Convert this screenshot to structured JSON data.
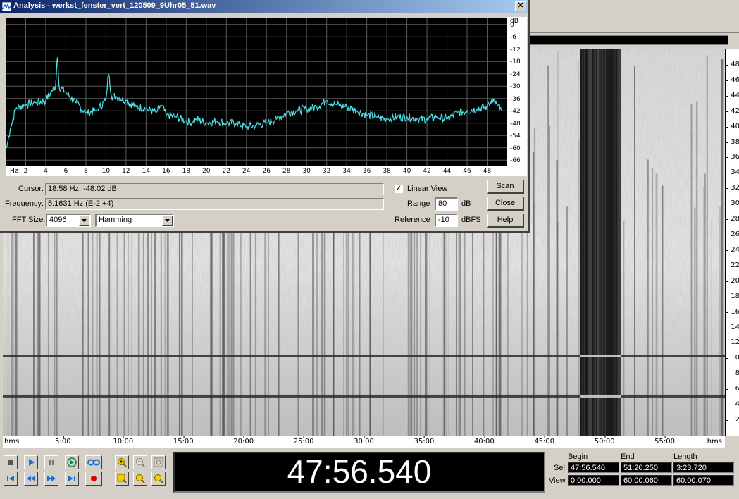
{
  "dialog": {
    "title": "Analysis - werkst_fenster_vert_120509_9Uhr05_51.wav",
    "close_glyph": "✕",
    "cursor_label": "Cursor:",
    "cursor_value": "18.58 Hz, -48.02 dB",
    "frequency_label": "Frequency:",
    "frequency_value": "5.1631 Hz (E-2 +4)",
    "fft_label": "FFT Size:",
    "fft_value": "4096",
    "window_value": "Hamming",
    "linear_view_label": "Linear View",
    "linear_view_checked": "✓",
    "range_label": "Range",
    "range_value": "80",
    "range_unit": "dB",
    "reference_label": "Reference",
    "reference_value": "-10",
    "reference_unit": "dBFS",
    "scan_label": "Scan",
    "close_label": "Close",
    "help_label": "Help"
  },
  "chart_data": {
    "type": "line",
    "x_unit_label": "Hz",
    "y_unit_label": "dB",
    "x_ticks": [
      "2",
      "4",
      "6",
      "8",
      "10",
      "12",
      "14",
      "16",
      "18",
      "20",
      "22",
      "24",
      "26",
      "28",
      "30",
      "32",
      "34",
      "36",
      "38",
      "40",
      "42",
      "44",
      "46",
      "48"
    ],
    "y_ticks": [
      "0",
      "-6",
      "-12",
      "-18",
      "-24",
      "-30",
      "-36",
      "-42",
      "-48",
      "-54",
      "-60",
      "-66"
    ],
    "xlim": [
      0,
      50
    ],
    "ylim": [
      -69,
      3
    ],
    "grid": true,
    "line_color": "#4fe0e8",
    "x": [
      0.1,
      0.5,
      1,
      2,
      3,
      4,
      4.5,
      5,
      5.15,
      5.3,
      6,
      7,
      8,
      9,
      10,
      10.3,
      10.5,
      11,
      12,
      13,
      14,
      15,
      15.5,
      16,
      17,
      18,
      18.6,
      19,
      20,
      21,
      22,
      23,
      24,
      25,
      26,
      27,
      28,
      29,
      30,
      31,
      32,
      33,
      34,
      35,
      36,
      37,
      38,
      39,
      40,
      41,
      42,
      43,
      44,
      45,
      46,
      47,
      48,
      48.5,
      49,
      49.5
    ],
    "y": [
      -60,
      -50,
      -41,
      -39,
      -38,
      -37,
      -33,
      -30,
      -12,
      -30,
      -33,
      -38,
      -43,
      -42,
      -37,
      -21,
      -35,
      -35,
      -37,
      -40,
      -41,
      -43,
      -39,
      -44,
      -45,
      -47,
      -48,
      -46,
      -48,
      -47,
      -48,
      -48,
      -50,
      -49,
      -48,
      -46,
      -43,
      -42,
      -41,
      -40,
      -37,
      -39,
      -40,
      -42,
      -44,
      -45,
      -46,
      -45,
      -45,
      -46,
      -46,
      -45,
      -46,
      -43,
      -42,
      -41,
      -40,
      -36,
      -39,
      -42
    ]
  },
  "spectrogram": {
    "freq_ticks": [
      "48",
      "46",
      "44",
      "42",
      "40",
      "38",
      "36",
      "34",
      "32",
      "30",
      "28",
      "26",
      "24",
      "22",
      "20",
      "18",
      "16",
      "14",
      "12",
      "10",
      "8",
      "6",
      "4",
      "2"
    ],
    "freq_range": [
      0,
      50
    ],
    "time_unit": "hms",
    "time_ticks": [
      "5:00",
      "10:00",
      "15:00",
      "20:00",
      "25:00",
      "30:00",
      "35:00",
      "40:00",
      "45:00",
      "50:00",
      "55:00"
    ],
    "time_range_min": [
      0,
      60
    ],
    "selection_min": [
      47.94,
      51.34
    ],
    "tone_lines_hz": [
      5.16,
      10.3
    ]
  },
  "transport": {
    "time_display": "47:56.540",
    "col_begin": "Begin",
    "col_end": "End",
    "col_length": "Length",
    "sel_label": "Sel",
    "view_label": "View",
    "sel_begin": "47:56.540",
    "sel_end": "51:20.250",
    "sel_length": "3:23.720",
    "view_begin": "0:00.000",
    "view_end": "60:00.060",
    "view_length": "60:00.070",
    "colors": {
      "play": "#1e6fd0",
      "loop": "#1e6fd0",
      "record": "#e00000",
      "zoom": "#f0d000"
    }
  }
}
